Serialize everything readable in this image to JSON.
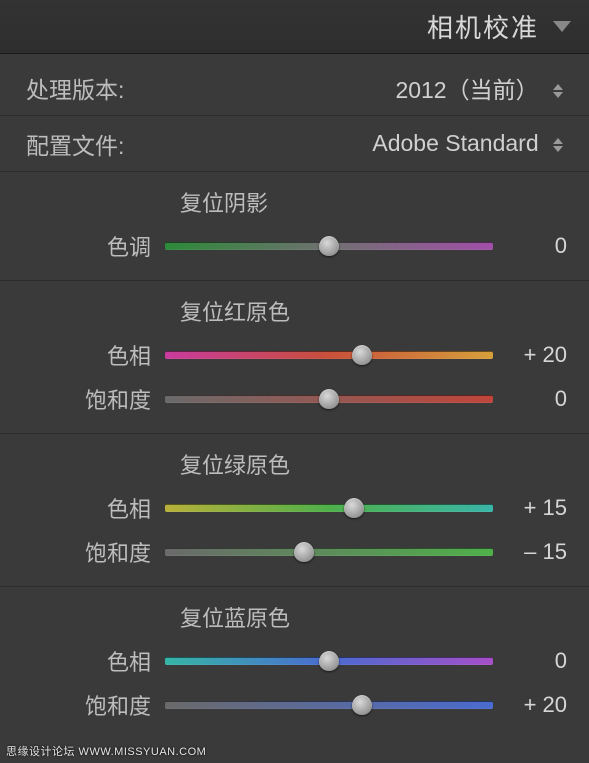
{
  "panel": {
    "title": "相机校准"
  },
  "process": {
    "label": "处理版本:",
    "value": "2012（当前）"
  },
  "profile": {
    "label": "配置文件:",
    "value": "Adobe Standard"
  },
  "shadows": {
    "title": "复位阴影",
    "tint": {
      "label": "色调",
      "value": "0",
      "pos": 50
    }
  },
  "red": {
    "title": "复位红原色",
    "hue": {
      "label": "色相",
      "value": "+ 20",
      "pos": 60
    },
    "sat": {
      "label": "饱和度",
      "value": "0",
      "pos": 50
    }
  },
  "green": {
    "title": "复位绿原色",
    "hue": {
      "label": "色相",
      "value": "+ 15",
      "pos": 57.5
    },
    "sat": {
      "label": "饱和度",
      "value": "– 15",
      "pos": 42.5
    }
  },
  "blue": {
    "title": "复位蓝原色",
    "hue": {
      "label": "色相",
      "value": "0",
      "pos": 50
    },
    "sat": {
      "label": "饱和度",
      "value": "+ 20",
      "pos": 60
    }
  },
  "watermark": "思缘设计论坛  WWW.MISSYUAN.COM"
}
